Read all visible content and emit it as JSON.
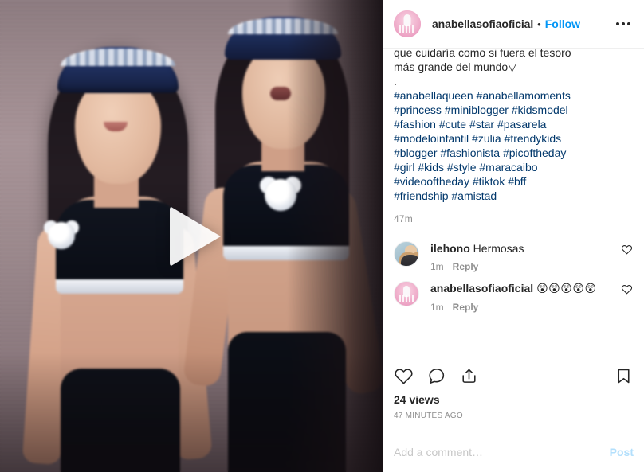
{
  "header": {
    "username": "anabellasofiaoficial",
    "separator": "•",
    "follow_label": "Follow",
    "more_label": "More options"
  },
  "caption": {
    "lines": [
      "que cuidaría como si fuera el tesoro",
      "más grande del mundo▽"
    ],
    "blank_marker": ".",
    "hashtag_lines": [
      "#anabellaqueen #anabellamoments",
      "#princess #miniblogger #kidsmodel",
      "#fashion #cute #star #pasarela",
      "#modeloinfantil #zulia #trendykids",
      "#blogger #fashionista #picoftheday",
      "#girl #kids #style #maracaibo",
      "#videooftheday #tiktok #bff",
      "#friendship #amistad"
    ],
    "timestamp": "47m"
  },
  "comments": [
    {
      "username": "ilehono",
      "text": "Hermosas",
      "timestamp": "1m",
      "reply_label": "Reply",
      "avatar_type": "photo"
    },
    {
      "username": "anabellasofiaoficial",
      "text": "😲😲😲😲😲",
      "timestamp": "1m",
      "reply_label": "Reply",
      "avatar_type": "brand"
    }
  ],
  "actions": {
    "like_label": "Like",
    "comment_label": "Comment",
    "share_label": "Share",
    "save_label": "Save",
    "views": "24 views",
    "posted_ago": "47 MINUTES AGO"
  },
  "add_comment": {
    "placeholder": "Add a comment…",
    "value": "",
    "post_label": "Post"
  },
  "media": {
    "type": "video",
    "play_label": "Play video"
  },
  "colors": {
    "accent_blue": "#0095f6",
    "link_blue": "#00376b",
    "text_primary": "#262626",
    "text_muted": "#8e8e8e",
    "border": "#efefef",
    "post_disabled": "#b2dffc",
    "brand_pink": "#e28ab4"
  }
}
